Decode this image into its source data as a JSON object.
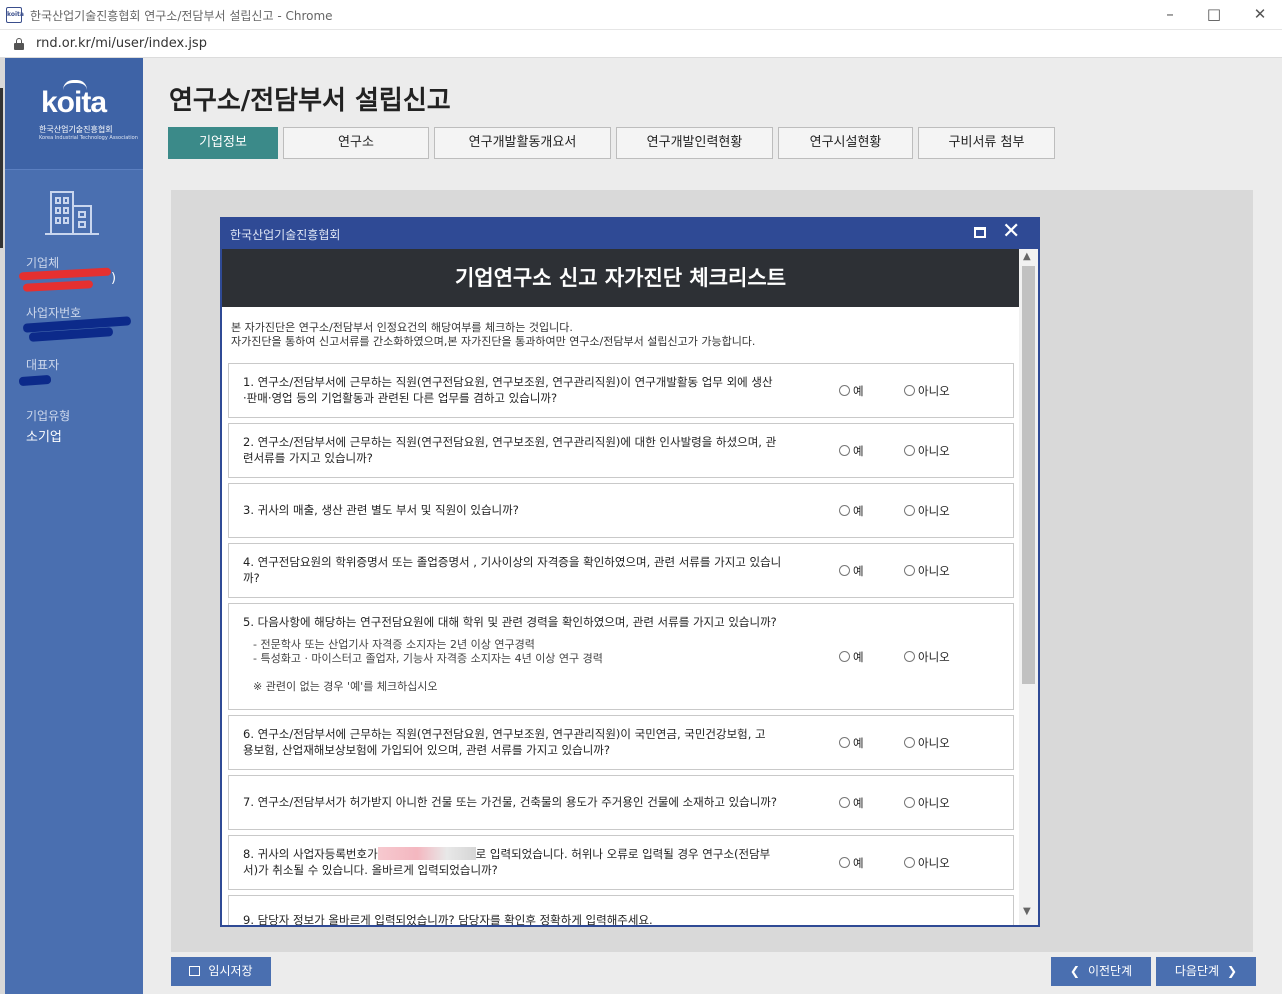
{
  "browser": {
    "favicon_text": "koita",
    "window_title": "한국산업기술진흥협회 연구소/전담부서 설립신고 - Chrome",
    "url": "rnd.or.kr/mi/user/index.jsp"
  },
  "sidebar": {
    "logo_text": "koita",
    "logo_subtitle": "한국산업기술진흥협회",
    "logo_subtitle_en": "Korea Industrial Technology Association",
    "company_label": "기업체",
    "company_value_suffix": ")",
    "biz_number_label": "사업자번호",
    "ceo_label": "대표자",
    "company_type_label": "기업유형",
    "company_type_value": "소기업"
  },
  "page": {
    "title": "연구소/전담부서 설립신고",
    "tabs": [
      "기업정보",
      "연구소",
      "연구개발활동개요서",
      "연구개발인력현황",
      "연구시설현황",
      "구비서류 첨부"
    ],
    "active_tab": 0
  },
  "footer": {
    "save_label": "임시저장",
    "prev_label": "이전단계",
    "next_label": "다음단계"
  },
  "modal": {
    "window_title": "한국산업기술진흥협회",
    "heading": "기업연구소 신고 자가진단 체크리스트",
    "intro_line1": "본 자가진단은 연구소/전담부서 인정요건의 해당여부를 체크하는 것입니다.",
    "intro_line2": "자가진단을 통하여 신고서류를 간소화하였으며,본 자가진단을 통과하여만 연구소/전담부서 설립신고가 가능합니다.",
    "yes_label": "예",
    "no_label": "아니오",
    "questions": [
      {
        "line1": "1. 연구소/전담부서에 근무하는 직원(연구전담요원, 연구보조원, 연구관리직원)이 연구개발활동 업무 외에 생산",
        "line2": "·판매·영업 등의 기업활동과 관련된 다른 업무를 겸하고 있습니까?"
      },
      {
        "line1": "2. 연구소/전담부서에 근무하는 직원(연구전담요원, 연구보조원, 연구관리직원)에 대한 인사발령을 하셨으며, 관",
        "line2": "련서류를 가지고 있습니까?"
      },
      {
        "line1": "3. 귀사의 매출, 생산 관련 별도 부서 및 직원이 있습니까?",
        "line2": ""
      },
      {
        "line1": "4. 연구전담요원의 학위증명서 또는 졸업증명서 , 기사이상의 자격증을 확인하였으며, 관련 서류를 가지고 있습니",
        "line2": "까?"
      },
      {
        "line1": "5. 다음사항에 해당하는 연구전담요원에 대해 학위 및 관련 경력을 확인하였으며, 관련 서류를 가지고 있습니까?",
        "line2": "",
        "sub1": "- 전문학사 또는 산업기사 자격증 소지자는 2년 이상 연구경력",
        "sub2": "- 특성화고 · 마이스터고 졸업자, 기능사 자격증 소지자는 4년 이상 연구 경력",
        "note": "※ 관련이 없는 경우 '예'를 체크하십시오"
      },
      {
        "line1": "6. 연구소/전담부서에 근무하는 직원(연구전담요원, 연구보조원, 연구관리직원)이 국민연금, 국민건강보험, 고",
        "line2": "용보험, 산업재해보상보험에 가입되어 있으며, 관련 서류를 가지고 있습니까?"
      },
      {
        "line1": "7. 연구소/전담부서가 허가받지 아니한 건물 또는 가건물, 건축물의 용도가 주거용인 건물에 소재하고 있습니까?",
        "line2": ""
      },
      {
        "line1_pre": "8. 귀사의 사업자등록번호가",
        "line1_post": "로 입력되었습니다. 허위나 오류로 입력될 경우 연구소(전담부",
        "line2": "서)가 취소될 수 있습니다. 올바르게 입력되었습니까?"
      },
      {
        "line1": "9. 담당자 정보가 올바르게 입력되었습니까? 담당자를 확인후 정확하게 입력해주세요.",
        "line2": ""
      }
    ]
  }
}
